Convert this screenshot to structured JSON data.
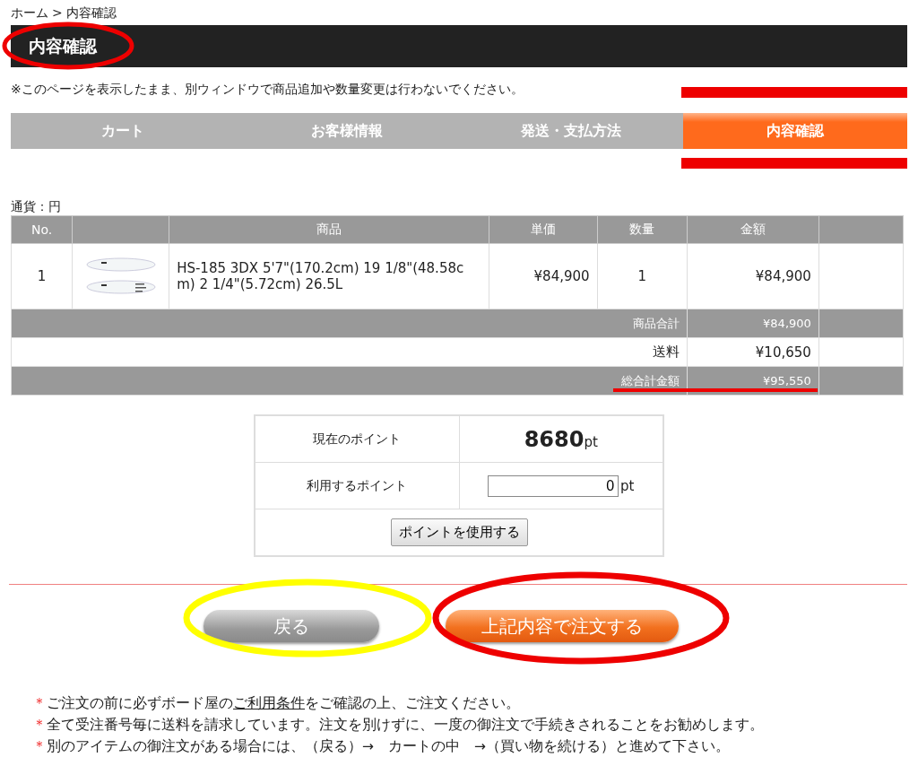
{
  "breadcrumb": {
    "home": "ホーム",
    "separator": ">",
    "current": "内容確認"
  },
  "page_title": "内容確認",
  "notice": "※このページを表示したまま、別ウィンドウで商品追加や数量変更は行わないでください。",
  "steps": [
    {
      "label": "カート",
      "selected": false
    },
    {
      "label": "お客様情報",
      "selected": false
    },
    {
      "label": "発送・支払方法",
      "selected": false
    },
    {
      "label": "内容確認",
      "selected": true
    }
  ],
  "currency": "通貨：円",
  "table": {
    "columns": [
      "No.",
      "",
      "商品",
      "単価",
      "数量",
      "金額",
      ""
    ],
    "rows": [
      {
        "no": "1",
        "product": "HS-185 3DX 5'7\"(170.2cm) 19 1/8\"(48.58cm) 2 1/4\"(5.72cm) 26.5L",
        "price": "¥84,900",
        "qty": "1",
        "amount": "¥84,900"
      }
    ],
    "summary": [
      {
        "label": "商品合計",
        "value": "¥84,900",
        "shaded": true
      },
      {
        "label": "送料",
        "value": "¥10,650",
        "shaded": false
      },
      {
        "label": "総合計金額",
        "value": "¥95,550",
        "shaded": true
      }
    ]
  },
  "points": {
    "current_label": "現在のポイント",
    "current_value": "8680",
    "unit": "pt",
    "use_label": "利用するポイント",
    "use_value": "0",
    "use_unit": "pt",
    "apply_button": "ポイントを使用する"
  },
  "buttons": [
    {
      "label": "戻る",
      "kind": "back"
    },
    {
      "label": "上記内容で注文する",
      "kind": "order"
    }
  ],
  "notes": [
    {
      "mark": "＊",
      "text": "ご注文の前に必ずボード屋の",
      "link": "ご利用条件",
      "text_after": "をご確認の上、ご注文ください。"
    },
    {
      "mark": "＊",
      "text": "全て受注番号毎に送料を請求しています。注文を別けずに、一度の御注文で手続きされることをお勧めします。"
    },
    {
      "mark": "＊",
      "text": "別のアイテムの御注文がある場合には、（戻る）→　カートの中　→（買い物を続ける）と進めて下さい。"
    }
  ]
}
